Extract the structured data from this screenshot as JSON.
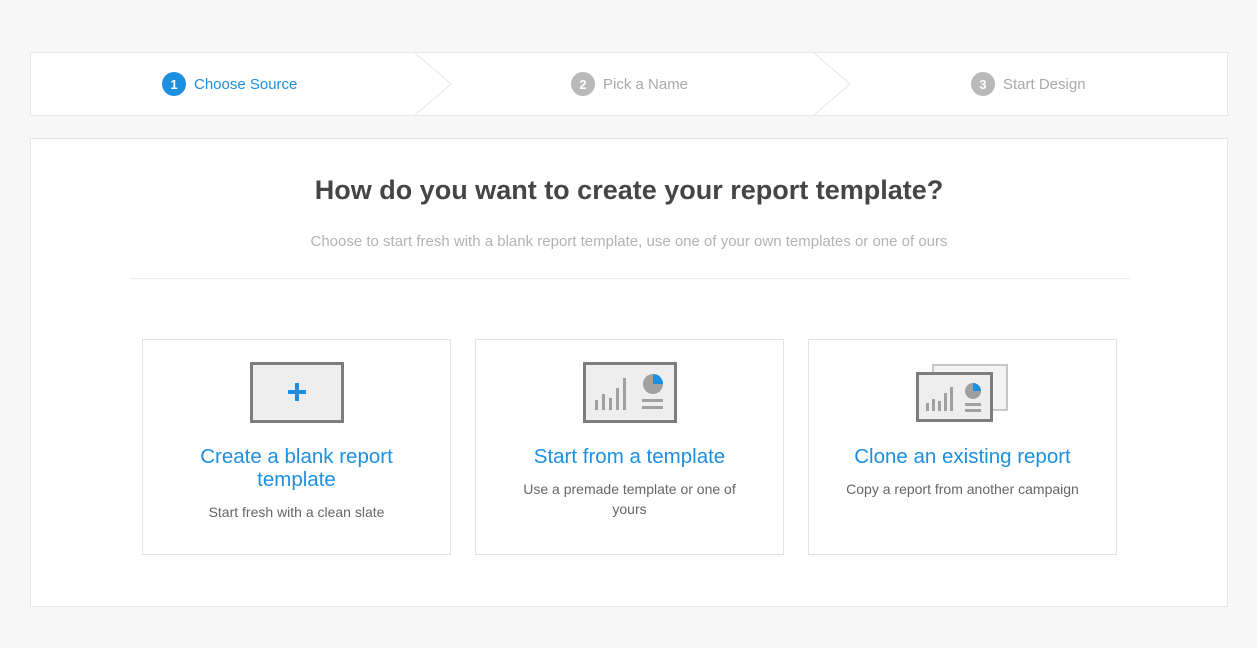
{
  "stepper": {
    "steps": [
      {
        "number": "1",
        "label": "Choose Source",
        "state": "active"
      },
      {
        "number": "2",
        "label": "Pick a Name",
        "state": "inactive"
      },
      {
        "number": "3",
        "label": "Start Design",
        "state": "inactive"
      }
    ]
  },
  "main": {
    "title": "How do you want to create your report template?",
    "subtitle": "Choose to start fresh with a blank report template, use one of your own templates or one of ours",
    "options": [
      {
        "icon": "blank-report-plus-icon",
        "title": "Create a blank report template",
        "description": "Start fresh with a clean slate"
      },
      {
        "icon": "report-template-icon",
        "title": "Start from a template",
        "description": "Use a premade template or one of yours"
      },
      {
        "icon": "clone-report-icon",
        "title": "Clone an existing report",
        "description": "Copy a report from another campaign"
      }
    ]
  },
  "colors": {
    "accent": "#1c8fe0",
    "inactive": "#b9b9b9",
    "heading": "#454545",
    "background": "#f7f7f7"
  }
}
